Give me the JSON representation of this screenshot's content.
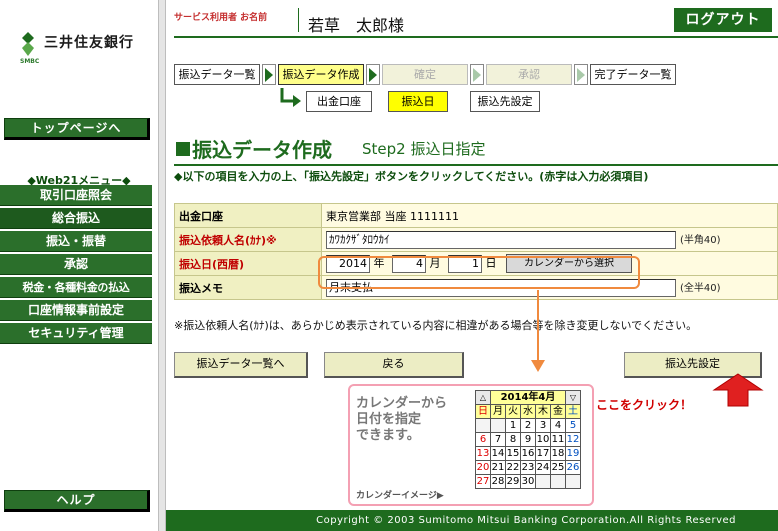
{
  "bank": {
    "name": "三井住友銀行",
    "sub": "SMBC"
  },
  "sidebar": {
    "top_button": "トップページへ",
    "web21_title": "◆Web21メニュー◆",
    "menu": [
      "取引口座照会",
      "総合振込",
      "振込・振替",
      "承認",
      "税金・各種料金の払込",
      "口座情報事前設定",
      "セキュリティ管理"
    ],
    "help_button": "ヘルプ"
  },
  "header": {
    "user_label": "サービス利用者 お名前",
    "user_name": "若草　太郎様",
    "logout": "ログアウト"
  },
  "steps": [
    "振込データ一覧",
    "振込データ作成",
    "確定",
    "承認",
    "完了データ一覧"
  ],
  "substeps": [
    "出金口座",
    "振込日",
    "振込先設定"
  ],
  "heading": {
    "title": "振込データ作成",
    "step": "Step2  振込日指定"
  },
  "instruction": "◆以下の項目を入力の上、「振込先設定」ボタンをクリックしてください。(赤字は入力必須項目)",
  "form": {
    "account_label": "出金口座",
    "account_value": "東京営業部 当座 1111111",
    "requester_label": "振込依頼人名(ｶﾅ)※",
    "requester_value": "ｶﾜｶｸｻﾞﾀﾛｳｶｲ",
    "requester_note": "(半角40)",
    "date_label": "振込日(西暦)",
    "year": "2014",
    "year_unit": "年",
    "month": "4",
    "month_unit": "月",
    "day": "1",
    "day_unit": "日",
    "calendar_button": "カレンダーから選択",
    "memo_label": "振込メモ",
    "memo_value": "月末支払",
    "memo_note": "(全半40)",
    "footnote": "※振込依頼人名(ｶﾅ)は、あらかじめ表示されている内容に相違がある場合等を除き変更しないでください。"
  },
  "buttons": {
    "list": "振込データ一覧へ",
    "back": "戻る",
    "next": "振込先設定"
  },
  "calendar_callout": {
    "text": [
      "カレンダーから",
      "日付を指定",
      "できます。"
    ],
    "image_label": "カレンダーイメージ▶",
    "prev": "△",
    "next": "▽",
    "month": "2014年4月",
    "weekdays": [
      "日",
      "月",
      "火",
      "水",
      "木",
      "金",
      "土"
    ],
    "weeks": [
      [
        "",
        "",
        "1",
        "2",
        "3",
        "4",
        "5"
      ],
      [
        "6",
        "7",
        "8",
        "9",
        "10",
        "11",
        "12"
      ],
      [
        "13",
        "14",
        "15",
        "16",
        "17",
        "18",
        "19"
      ],
      [
        "20",
        "21",
        "22",
        "23",
        "24",
        "25",
        "26"
      ],
      [
        "27",
        "28",
        "29",
        "30",
        "",
        "",
        ""
      ]
    ]
  },
  "click_hint": "ここをクリック！",
  "footer": "Copyright © 2003 Sumitomo Mitsui Banking Corporation.All Rights Reserved",
  "colors": {
    "brand_green": "#1e6b1e",
    "accent_orange": "#f08a3e",
    "alert_red": "#d00000"
  }
}
